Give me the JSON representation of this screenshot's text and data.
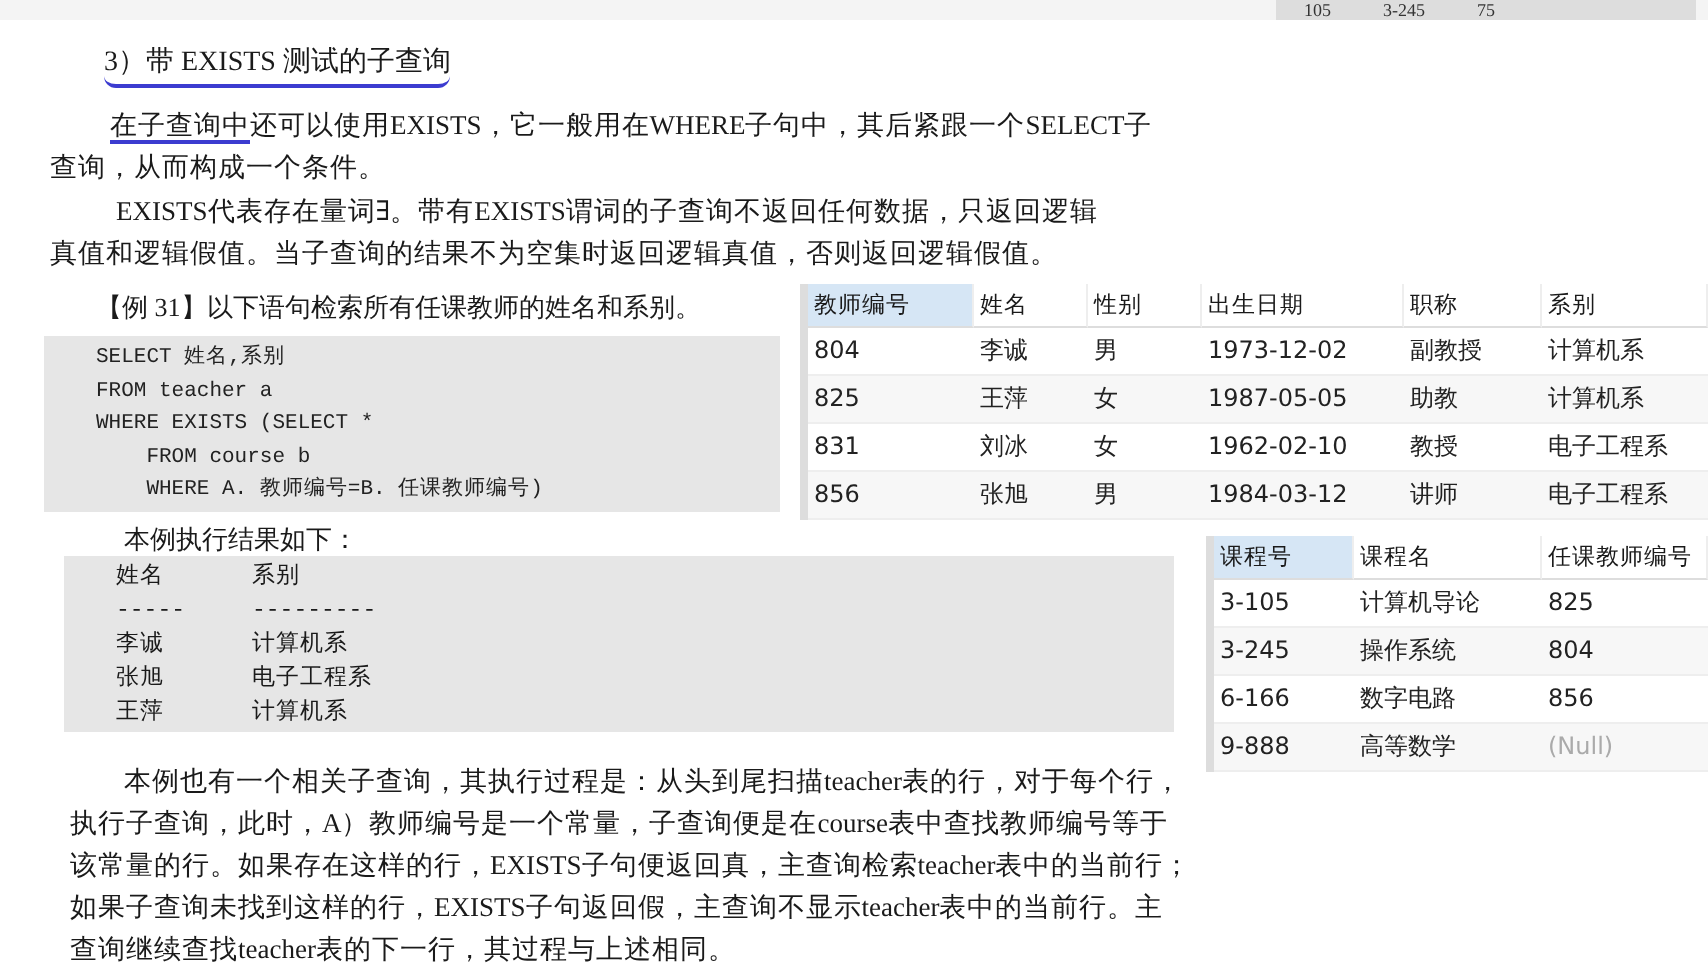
{
  "top_strip": {
    "cells": [
      "105",
      "3-245",
      "75"
    ]
  },
  "heading": {
    "text": "3）带 EXISTS 测试的子查询",
    "annotated": true
  },
  "intro_paragraphs": [
    {
      "underlined_lead": "在子查询中",
      "lines": [
        "还可以使用EXISTS，它一般用在WHERE子句中，其后紧跟一个SELECT子",
        "查询，从而构成一个条件。"
      ]
    },
    {
      "lines": [
        "EXISTS代表存在量词∃。带有EXISTS谓词的子查询不返回任何数据，只返回逻辑",
        "真值和逻辑假值。当子查询的结果不为空集时返回逻辑真值，否则返回逻辑假值。"
      ]
    }
  ],
  "example": {
    "title": "【例 31】以下语句检索所有任课教师的姓名和系别。",
    "code": [
      "SELECT 姓名,系别",
      "FROM teacher a",
      "WHERE EXISTS (SELECT *",
      "    FROM course b",
      "    WHERE A. 教师编号=B. 任课教师编号)"
    ],
    "result_caption": "本例执行结果如下：",
    "result": {
      "columns": [
        "姓名",
        "系别"
      ],
      "separators": [
        "-----",
        "---------"
      ],
      "rows": [
        [
          "李诚",
          "计算机系"
        ],
        [
          "张旭",
          "电子工程系"
        ],
        [
          "王萍",
          "计算机系"
        ]
      ]
    }
  },
  "teacher_table": {
    "columns": [
      {
        "label": "教师编号",
        "selected": true
      },
      {
        "label": "姓名",
        "selected": false
      },
      {
        "label": "性别",
        "selected": false
      },
      {
        "label": "出生日期",
        "selected": false
      },
      {
        "label": "职称",
        "selected": false
      },
      {
        "label": "系别",
        "selected": false
      }
    ],
    "rows": [
      [
        "804",
        "李诚",
        "男",
        "1973-12-02",
        "副教授",
        "计算机系"
      ],
      [
        "825",
        "王萍",
        "女",
        "1987-05-05",
        "助教",
        "计算机系"
      ],
      [
        "831",
        "刘冰",
        "女",
        "1962-02-10",
        "教授",
        "电子工程系"
      ],
      [
        "856",
        "张旭",
        "男",
        "1984-03-12",
        "讲师",
        "电子工程系"
      ]
    ]
  },
  "course_table": {
    "columns": [
      {
        "label": "课程号",
        "selected": true
      },
      {
        "label": "课程名",
        "selected": false
      },
      {
        "label": "任课教师编号",
        "selected": false
      }
    ],
    "rows": [
      {
        "cells": [
          "3-105",
          "计算机导论",
          "825"
        ],
        "last_is_null": false
      },
      {
        "cells": [
          "3-245",
          "操作系统",
          "804"
        ],
        "last_is_null": false
      },
      {
        "cells": [
          "6-166",
          "数字电路",
          "856"
        ],
        "last_is_null": false
      },
      {
        "cells": [
          "9-888",
          "高等数学",
          "(Null)"
        ],
        "last_is_null": true
      }
    ]
  },
  "closing_paragraph": {
    "lines": [
      "本例也有一个相关子查询，其执行过程是：从头到尾扫描teacher表的行，对于每个行，",
      "执行子查询，此时，A）教师编号是一个常量，子查询便是在course表中查找教师编号等于",
      "该常量的行。如果存在这样的行，EXISTS子句便返回真，主查询检索teacher表中的当前行；",
      "如果子查询未找到这样的行，EXISTS子句返回假，主查询不显示teacher表中的当前行。主",
      "查询继续查找teacher表的下一行，其过程与上述相同。"
    ]
  }
}
